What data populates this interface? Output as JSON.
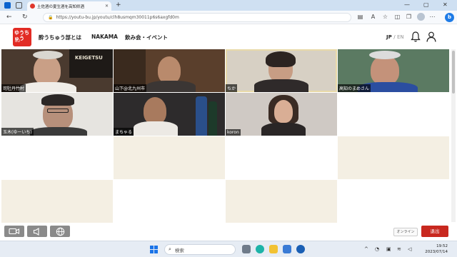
{
  "browser": {
    "tab_title": "土佐酒の夏生酒を高知県酒",
    "url": "https://youtu-bu.jp/youtu/clh8usmqm30011p6s6axgfd0m"
  },
  "site": {
    "logo_text": "ゆうちゅう",
    "logo_sub": "BU",
    "nav": [
      {
        "label": "酔うちゅう部とは"
      },
      {
        "label": "NAKAMA"
      },
      {
        "label": "飲み会・イベント"
      }
    ],
    "lang_jp": "JP",
    "lang_sep": "/",
    "lang_en": "EN"
  },
  "participants": [
    {
      "name": "司牡丹竹村",
      "banner": "KEIGETSU"
    },
    {
      "name": "山下@北九州市"
    },
    {
      "name": "ちか"
    },
    {
      "name": "高知のまめさん"
    },
    {
      "name": "玉木(ゆーいち)"
    },
    {
      "name": "まちゃる"
    },
    {
      "name": "koron"
    }
  ],
  "controls": {
    "online_label": "オンライン",
    "exit_label": "退出"
  },
  "taskbar": {
    "search_placeholder": "検索",
    "time": "19:52",
    "date": "2023/07/14"
  },
  "colors": {
    "brand_red": "#e22b24",
    "exit_red": "#c8281f",
    "empty_beige": "#f4efe3",
    "control_gray": "#8a8a8a"
  }
}
